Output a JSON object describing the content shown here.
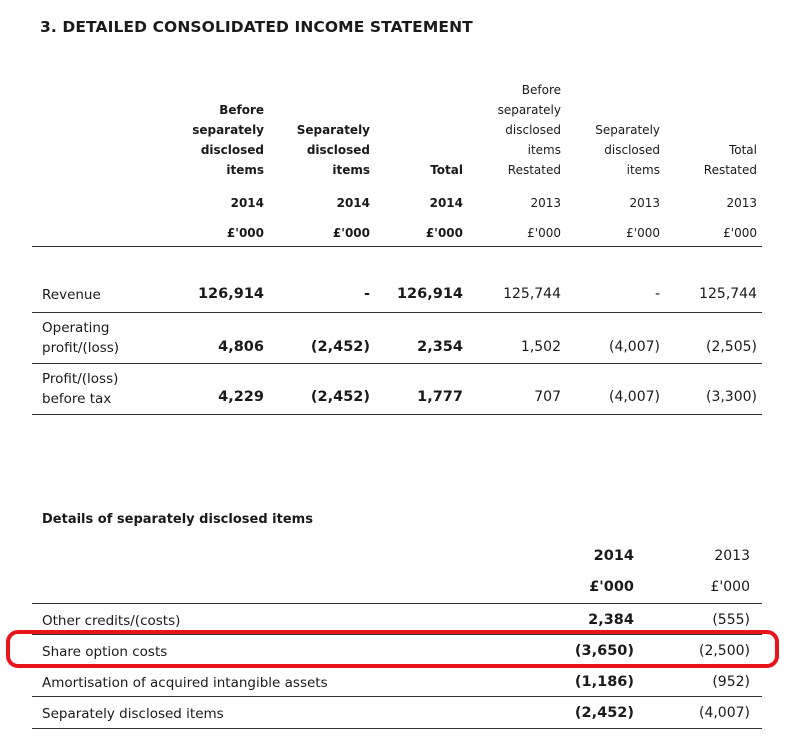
{
  "title": "3. DETAILED CONSOLIDATED INCOME STATEMENT",
  "headers": [
    {
      "lines": [
        "Before",
        "separately",
        "disclosed",
        "items"
      ],
      "year": "2014",
      "unit": "£'000",
      "bold": true
    },
    {
      "lines": [
        "Separately",
        "disclosed",
        "items"
      ],
      "year": "2014",
      "unit": "£'000",
      "bold": true
    },
    {
      "lines": [
        "Total"
      ],
      "year": "2014",
      "unit": "£'000",
      "bold": true
    },
    {
      "lines": [
        "Before",
        "separately",
        "disclosed",
        "items",
        "Restated"
      ],
      "year": "2013",
      "unit": "£'000",
      "bold": false
    },
    {
      "lines": [
        "Separately",
        "disclosed",
        "items"
      ],
      "year": "2013",
      "unit": "£'000",
      "bold": false
    },
    {
      "lines": [
        "Total",
        "Restated"
      ],
      "year": "2013",
      "unit": "£'000",
      "bold": false
    }
  ],
  "rows": [
    {
      "label": [
        "Revenue"
      ],
      "values": [
        "126,914",
        "-",
        "126,914",
        "125,744",
        "-",
        "125,744"
      ]
    },
    {
      "label": [
        "Operating",
        "profit/(loss)"
      ],
      "values": [
        "4,806",
        "(2,452)",
        "2,354",
        "1,502",
        "(4,007)",
        "(2,505)"
      ]
    },
    {
      "label": [
        "Profit/(loss)",
        "before tax"
      ],
      "values": [
        "4,229",
        "(2,452)",
        "1,777",
        "707",
        "(4,007)",
        "(3,300)"
      ]
    }
  ],
  "details": {
    "title": "Details of separately disclosed items",
    "col_2014": "2014",
    "col_2013": "2013",
    "unit_2014": "£'000",
    "unit_2013": "£'000",
    "rows": [
      {
        "label": "Other credits/(costs)",
        "v2014": "2,384",
        "v2013": "(555)"
      },
      {
        "label": "Share option costs",
        "v2014": "(3,650)",
        "v2013": "(2,500)"
      },
      {
        "label": "Amortisation of acquired intangible assets",
        "v2014": "(1,186)",
        "v2013": "(952)"
      },
      {
        "label": "Separately disclosed items",
        "v2014": "(2,452)",
        "v2013": "(4,007)"
      }
    ]
  },
  "highlight_color": "#e8141c"
}
